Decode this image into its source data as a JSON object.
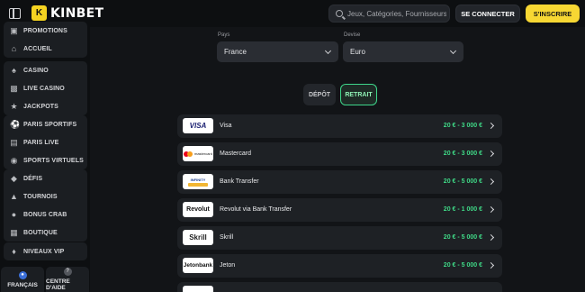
{
  "header": {
    "brand": "KINBET",
    "search_placeholder": "Jeux, Catégories, Fournisseurs",
    "login_label": "SE CONNECTER",
    "register_label": "S'INSCRIRE"
  },
  "sidebar": {
    "groups": [
      [
        {
          "label": "PROMOTIONS",
          "icon": "gift-icon"
        },
        {
          "label": "ACCUEIL",
          "icon": "home-icon"
        }
      ],
      [
        {
          "label": "CASINO",
          "icon": "cards-icon"
        },
        {
          "label": "LIVE CASINO",
          "icon": "live-icon"
        },
        {
          "label": "JACKPOTS",
          "icon": "jackpot-icon"
        }
      ],
      [
        {
          "label": "PARIS SPORTIFS",
          "icon": "ball-icon"
        },
        {
          "label": "PARIS LIVE",
          "icon": "tv-icon"
        },
        {
          "label": "SPORTS VIRTUELS",
          "icon": "virtual-icon"
        }
      ],
      [
        {
          "label": "DÉFIS",
          "icon": "challenge-icon"
        },
        {
          "label": "TOURNOIS",
          "icon": "trophy-icon"
        },
        {
          "label": "BONUS CRAB",
          "icon": "crab-icon"
        },
        {
          "label": "BOUTIQUE",
          "icon": "shop-icon"
        }
      ],
      [
        {
          "label": "NIVEAUX VIP",
          "icon": "vip-icon"
        }
      ]
    ],
    "bottom": {
      "language_label": "FRANÇAIS",
      "help_label": "CENTRE D'AIDE"
    }
  },
  "filters": {
    "country_label": "Pays",
    "country_value": "France",
    "currency_label": "Devise",
    "currency_value": "Euro"
  },
  "tabs": {
    "deposit": "DÉPÔT",
    "withdraw": "RETRAIT",
    "active": "withdraw"
  },
  "accent_color": "#3fd886",
  "brand_color": "#f7d733",
  "methods": [
    {
      "name": "Visa",
      "range": "20 € - 3 000 €",
      "logo_text": "VISA"
    },
    {
      "name": "Mastercard",
      "range": "20 € - 3 000 €",
      "logo_text": "mastercard"
    },
    {
      "name": "Bank Transfer",
      "range": "20 € - 5 000 €",
      "logo_text": "INFINITY"
    },
    {
      "name": "Revolut via Bank Transfer",
      "range": "20 € - 1 000 €",
      "logo_text": "Revolut"
    },
    {
      "name": "Skrill",
      "range": "20 € - 5 000 €",
      "logo_text": "Skrill"
    },
    {
      "name": "Jeton",
      "range": "20 € - 5 000 €",
      "logo_text": "Jetonbank"
    }
  ]
}
